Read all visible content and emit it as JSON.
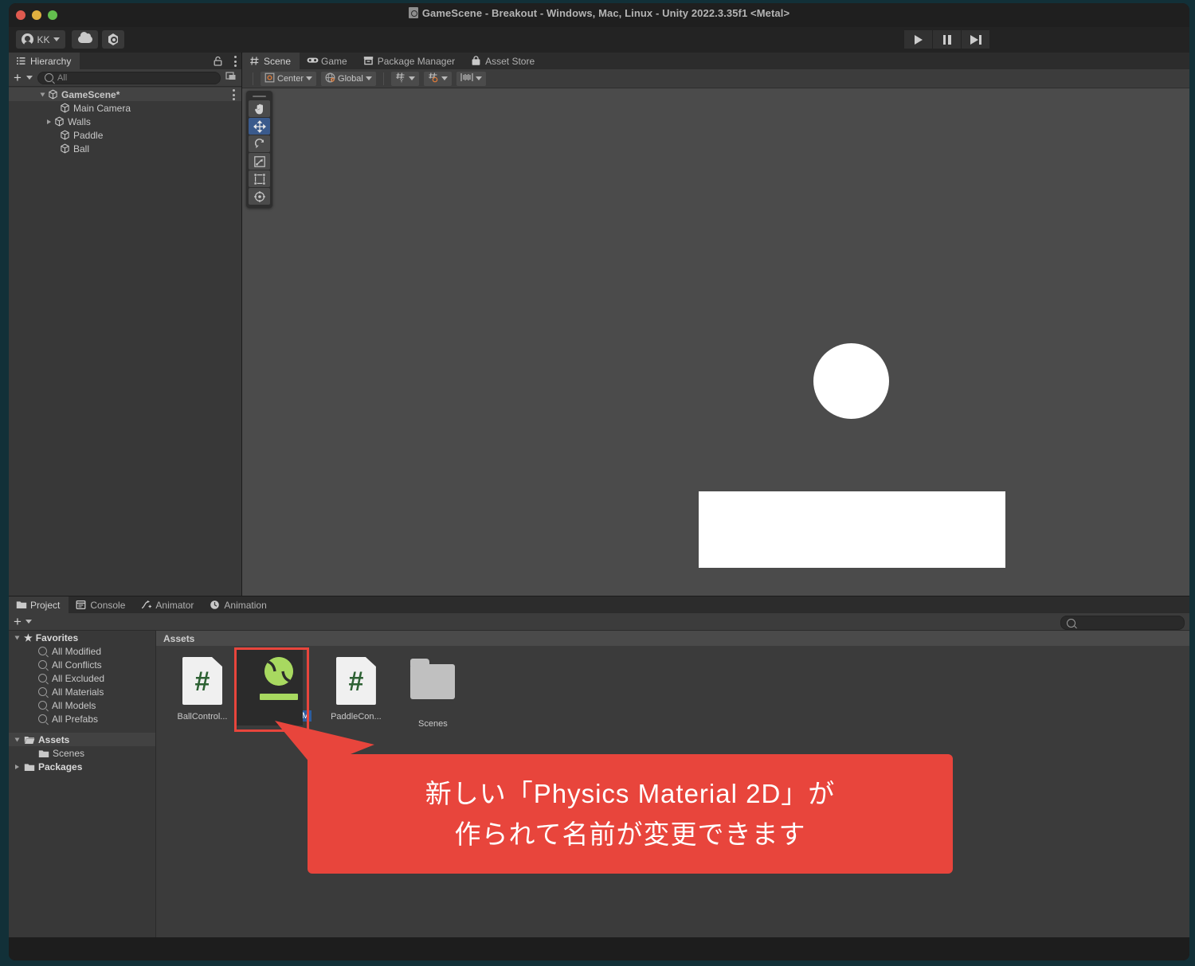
{
  "window": {
    "title": "GameScene - Breakout - Windows, Mac, Linux - Unity 2022.3.35f1 <Metal>",
    "title_icon": "unity-scene-icon"
  },
  "toolbar": {
    "account_label": "KK",
    "account_icon": "account-avatar-icon",
    "cloud_icon": "cloud-icon",
    "services_icon": "unity-services-icon",
    "play_icon": "play-icon",
    "pause_icon": "pause-icon",
    "step_icon": "step-icon"
  },
  "hierarchy": {
    "tab_label": "Hierarchy",
    "tab_icon": "hierarchy-icon",
    "lock_icon": "lock-icon",
    "menu_icon": "kebab-menu-icon",
    "add_label": "+",
    "search_placeholder": "All",
    "search_value": "",
    "items": [
      {
        "label": "GameScene*",
        "depth": 0,
        "expanded": true,
        "selected": false,
        "has_children": true
      },
      {
        "label": "Main Camera",
        "depth": 1,
        "expanded": false,
        "selected": false,
        "has_children": false
      },
      {
        "label": "Walls",
        "depth": 1,
        "expanded": false,
        "selected": false,
        "has_children": true
      },
      {
        "label": "Paddle",
        "depth": 1,
        "expanded": false,
        "selected": false,
        "has_children": false
      },
      {
        "label": "Ball",
        "depth": 1,
        "expanded": false,
        "selected": false,
        "has_children": false
      }
    ]
  },
  "scene": {
    "tabs": [
      {
        "label": "Scene",
        "icon": "grid-icon",
        "active": true
      },
      {
        "label": "Game",
        "icon": "gamepad-icon",
        "active": false
      },
      {
        "label": "Package Manager",
        "icon": "package-icon",
        "active": false
      },
      {
        "label": "Asset Store",
        "icon": "store-icon",
        "active": false
      }
    ],
    "pivot_label": "Center",
    "pivot_icon": "pivot-center-icon",
    "space_label": "Global",
    "space_icon": "globe-icon",
    "grid_icon": "grid-snap-icon",
    "snap_icon": "snap-increment-icon",
    "ruler_icon": "scene-ruler-icon",
    "tools": [
      {
        "name": "hand-tool",
        "selected": false
      },
      {
        "name": "move-tool",
        "selected": true
      },
      {
        "name": "rotate-tool",
        "selected": false
      },
      {
        "name": "scale-tool",
        "selected": false
      },
      {
        "name": "rect-tool",
        "selected": false
      },
      {
        "name": "transform-tool",
        "selected": false
      }
    ],
    "objects": {
      "ball_label": "Ball",
      "paddle_label": "Paddle"
    }
  },
  "project": {
    "tabs": [
      {
        "label": "Project",
        "icon": "folder-icon",
        "active": true
      },
      {
        "label": "Console",
        "icon": "console-icon",
        "active": false
      },
      {
        "label": "Animator",
        "icon": "animator-icon",
        "active": false
      },
      {
        "label": "Animation",
        "icon": "animation-icon",
        "active": false
      }
    ],
    "add_label": "+",
    "search_placeholder": "",
    "search_value": "",
    "breadcrumb": "Assets",
    "tree": [
      {
        "label": "Favorites",
        "depth": 0,
        "icon": "star-icon",
        "expanded": true,
        "bold": true
      },
      {
        "label": "All Modified",
        "depth": 1,
        "icon": "search-icon",
        "expanded": false,
        "bold": false
      },
      {
        "label": "All Conflicts",
        "depth": 1,
        "icon": "search-icon",
        "expanded": false,
        "bold": false
      },
      {
        "label": "All Excluded",
        "depth": 1,
        "icon": "search-icon",
        "expanded": false,
        "bold": false
      },
      {
        "label": "All Materials",
        "depth": 1,
        "icon": "search-icon",
        "expanded": false,
        "bold": false
      },
      {
        "label": "All Models",
        "depth": 1,
        "icon": "search-icon",
        "expanded": false,
        "bold": false
      },
      {
        "label": "All Prefabs",
        "depth": 1,
        "icon": "search-icon",
        "expanded": false,
        "bold": false
      },
      {
        "label": "Assets",
        "depth": 0,
        "icon": "folder-open-icon",
        "expanded": true,
        "bold": true
      },
      {
        "label": "Scenes",
        "depth": 1,
        "icon": "folder-icon",
        "expanded": false,
        "bold": false
      },
      {
        "label": "Packages",
        "depth": 0,
        "icon": "folder-icon",
        "expanded": false,
        "bold": true
      }
    ],
    "assets": [
      {
        "label": "BallControl...",
        "type": "csharp-script",
        "selected": false,
        "editing": false
      },
      {
        "label": "New Physics M",
        "type": "physics-material-2d",
        "selected": true,
        "editing": true
      },
      {
        "label": "PaddleCon...",
        "type": "csharp-script",
        "selected": false,
        "editing": false
      },
      {
        "label": "Scenes",
        "type": "folder",
        "selected": false,
        "editing": false
      }
    ]
  },
  "callout": {
    "line1": "新しい「Physics Material 2D」が",
    "line2": "作られて名前が変更できます",
    "color": "#e8453c"
  },
  "colors": {
    "accent_red": "#e8453c",
    "selection_blue": "#2c5d9e",
    "tool_selected_blue": "#3a5a8c",
    "physics_green": "#a8d960",
    "panel_bg": "#383838",
    "viewport_bg": "#4b4b4b"
  }
}
